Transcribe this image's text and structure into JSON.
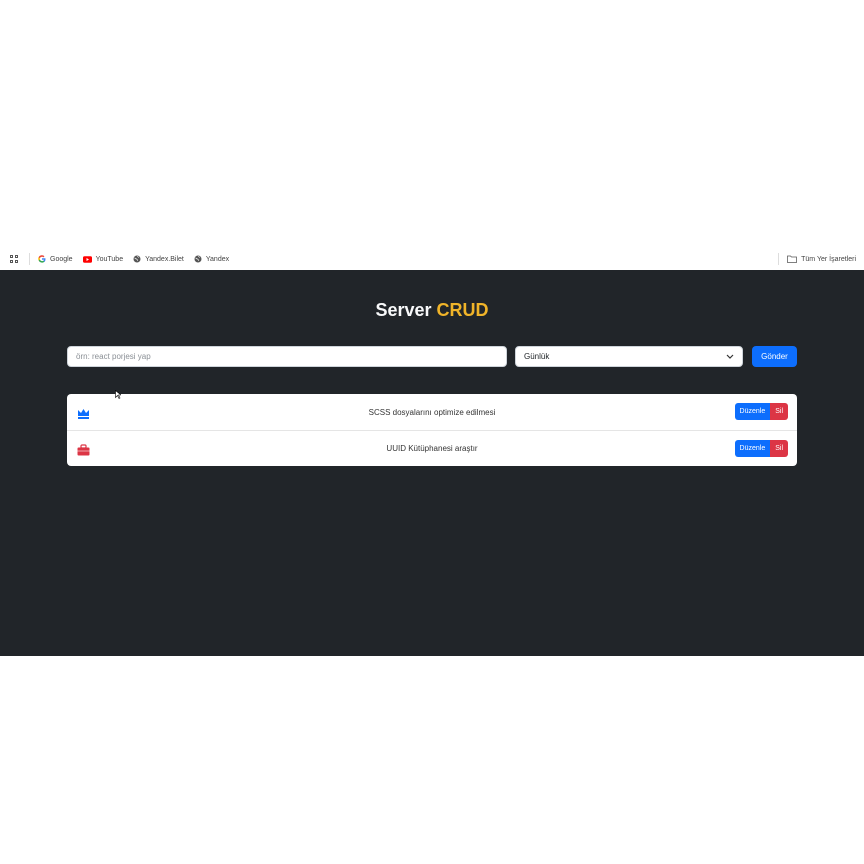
{
  "bookmarks": {
    "items": [
      {
        "label": "Google",
        "icon": "google-icon"
      },
      {
        "label": "YouTube",
        "icon": "youtube-icon"
      },
      {
        "label": "Yandex.Bilet",
        "icon": "globe-icon"
      },
      {
        "label": "Yandex",
        "icon": "globe-icon"
      }
    ],
    "all_bookmarks_label": "Tüm Yer İşaretleri"
  },
  "header": {
    "title_main": "Server",
    "title_accent": "CRUD",
    "accent_color": "#f0b429"
  },
  "form": {
    "input_value": "",
    "input_placeholder": "örn: react porjesi yap",
    "select_value": "Günlük",
    "submit_label": "Gönder"
  },
  "tasks": [
    {
      "icon": "crown-icon",
      "icon_color": "#0d6efd",
      "text": "SCSS dosyalarını optimize edilmesi",
      "edit_label": "Düzenle",
      "delete_label": "Sil"
    },
    {
      "icon": "briefcase-icon",
      "icon_color": "#dc3545",
      "text": "UUID Kütüphanesi araştır",
      "edit_label": "Düzenle",
      "delete_label": "Sil"
    }
  ],
  "colors": {
    "background": "#212529",
    "primary": "#0d6efd",
    "danger": "#dc3545"
  }
}
